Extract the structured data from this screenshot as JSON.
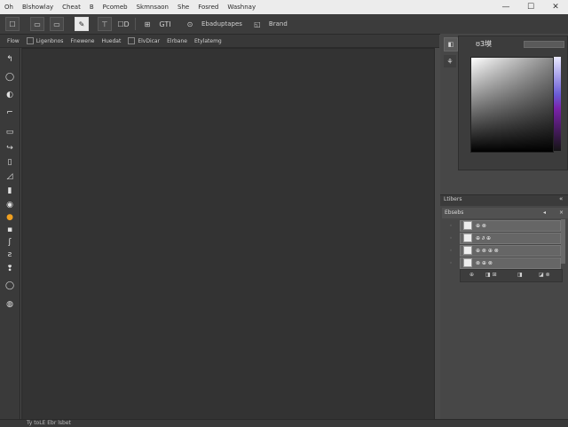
{
  "menu": {
    "items": [
      "Oh",
      "Blshowlay",
      "Cheat",
      "B",
      "Pcomeb",
      "Skmnsaon",
      "She",
      "Fosred",
      "Washnay"
    ]
  },
  "window_controls": {
    "minimize": "—",
    "maximize": "☐",
    "close": "✕"
  },
  "options_bar": {
    "item1": "☐",
    "item2": "▭",
    "item3": "▭",
    "active_tool": "✎",
    "item4": "⊤",
    "item5": "☐D",
    "item6": "⊞",
    "item7": "GTI",
    "item8": "⊙",
    "label8": "Ebaduptapes",
    "item9": "◱",
    "label9": "Brand"
  },
  "options_bar2": {
    "items": [
      "Flow",
      "Ligenbnos",
      "Fnewene",
      "Huedat",
      "ElvDicar",
      "Elrbane",
      "Etylatemg"
    ]
  },
  "tools": [
    "↰",
    "◯",
    "◐",
    "⌐",
    "▭",
    "↪",
    "▯",
    "◿",
    "▮",
    "◉",
    "●",
    "▪",
    "ʃ",
    "ƨ",
    "❢",
    "◯",
    "◍"
  ],
  "color_panel": {
    "tab1": "◧",
    "tab2": "⚘",
    "title": "ʊ3塻"
  },
  "layers_panel": {
    "title": "Ltibers",
    "close": "«",
    "sub_left": "Ebsebs",
    "sub_right1": "◂",
    "sub_right2": "×",
    "rows": [
      {
        "eye": "◦",
        "name": "⊕ ⊗"
      },
      {
        "eye": "◦",
        "name": "⊕ ∂ ⊕"
      },
      {
        "eye": "◦",
        "name": "⊕ ⊗ ⊕ ⊗"
      },
      {
        "eye": "◦",
        "name": "⊗ ⊕ ⊗"
      }
    ],
    "footer": {
      "a": "⊕",
      "b": "◨ ⊞",
      "c": "◨",
      "d": "◪ ⊗"
    }
  },
  "status": {
    "text": "Ty toLE Ebr lsbet"
  },
  "colors": {
    "chrome": "#ececec",
    "panel": "#3c3c3c",
    "canvas": "#333333",
    "hue_accent": "#7a22aa"
  }
}
